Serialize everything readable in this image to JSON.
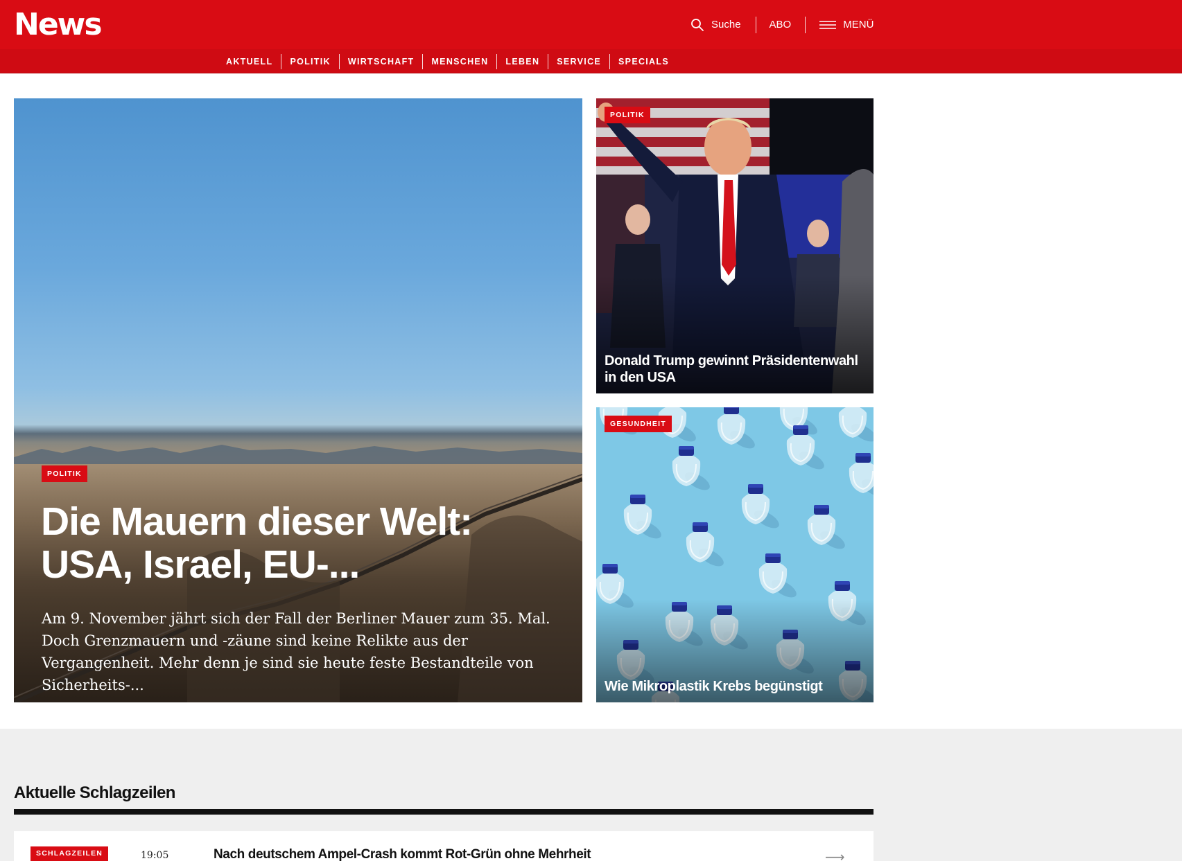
{
  "header": {
    "logo": "News",
    "search_label": "Suche",
    "abo_label": "ABO",
    "menu_label": "MENÜ",
    "nav": [
      "AKTUELL",
      "POLITIK",
      "WIRTSCHAFT",
      "MENSCHEN",
      "LEBEN",
      "SERVICE",
      "SPECIALS"
    ]
  },
  "hero": {
    "tag": "POLITIK",
    "title": "Die Mauern dieser Welt: USA, Israel, EU-...",
    "lead": "Am 9. November jährt sich der Fall der Berliner Mauer zum 35. Mal. Doch Grenzmauern und -zäune sind keine Relikte aus der Vergangenheit. Mehr denn je sind sie heute feste Bestandteile von Sicherheits-..."
  },
  "teasers": [
    {
      "tag": "POLITIK",
      "title": "Donald Trump gewinnt Präsidentenwahl in den USA"
    },
    {
      "tag": "GESUNDHEIT",
      "title": "Wie Mikroplastik Krebs begünstigt"
    }
  ],
  "headlines": {
    "title": "Aktuelle Schlagzeilen",
    "items": [
      {
        "tag": "SCHLAGZEILEN",
        "time": "19:05",
        "title": "Nach deutschem Ampel-Crash kommt Rot-Grün ohne Mehrheit"
      }
    ]
  },
  "colors": {
    "brand_red": "#d90c14",
    "nav_red": "#cf0b13",
    "section_grey": "#efefef",
    "text_dark": "#111111"
  }
}
